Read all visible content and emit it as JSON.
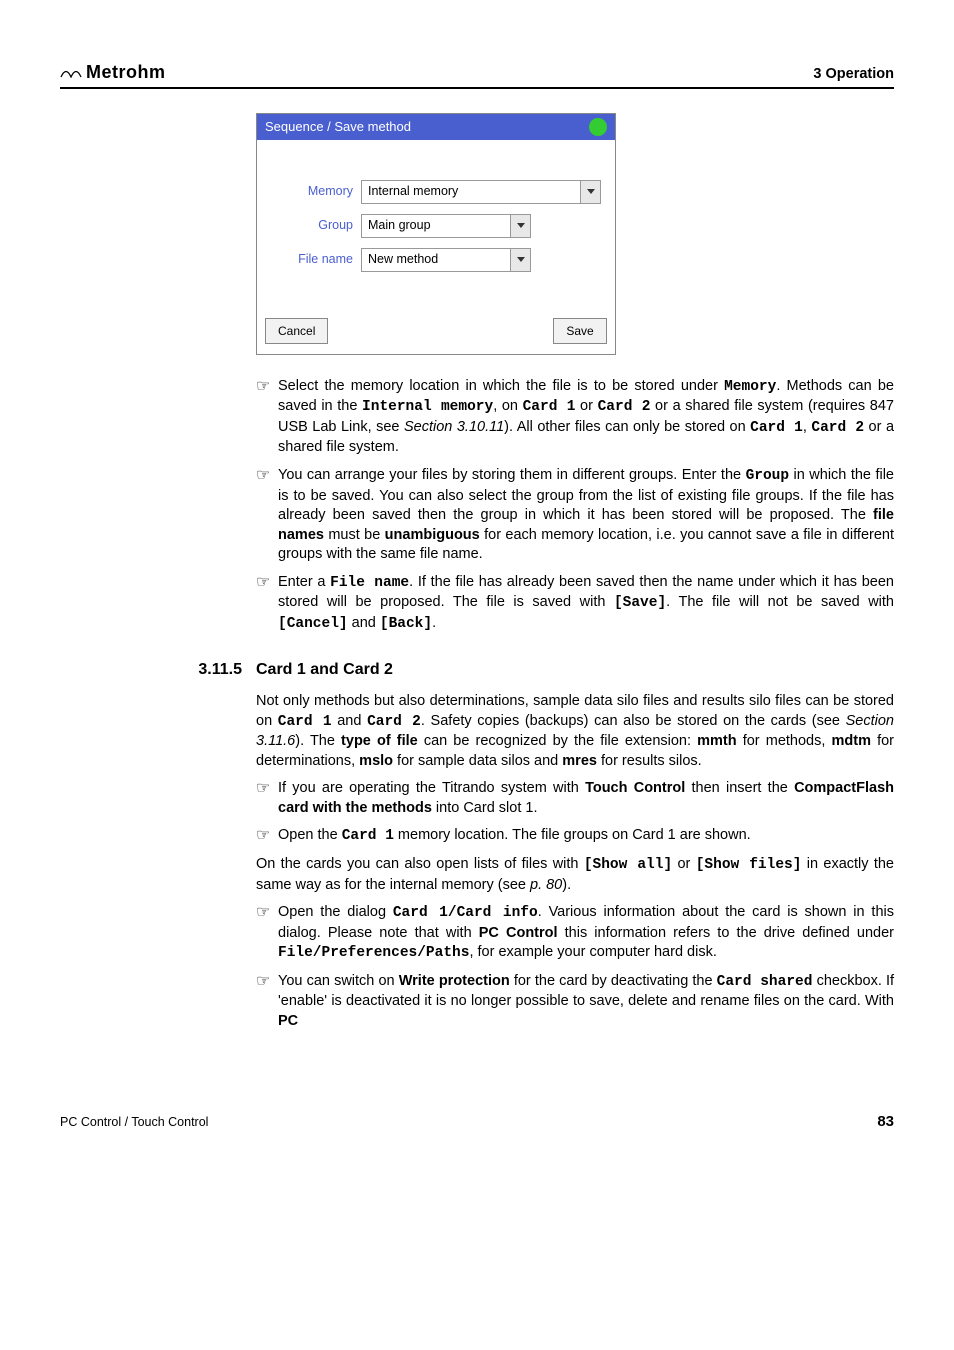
{
  "header": {
    "brand": "Metrohm",
    "section": "3 Operation"
  },
  "dialog": {
    "title": "Sequence / Save method",
    "rows": [
      {
        "label": "Memory",
        "value": "Internal memory",
        "wide": true
      },
      {
        "label": "Group",
        "value": "Main group",
        "wide": false
      },
      {
        "label": "File name",
        "value": "New method",
        "wide": false
      }
    ],
    "cancel": "Cancel",
    "save": "Save"
  },
  "bullets1": {
    "b1_a": "Select the memory location in which the file is to be stored under ",
    "b1_memory": "Memory",
    "b1_b": ". Methods can be saved in the ",
    "b1_internal": "Internal memory",
    "b1_c": ", on ",
    "b1_card1": "Card 1",
    "b1_d": " or ",
    "b1_card2": "Card 2",
    "b1_e": " or a shared file system (requires 847 USB Lab Link, see ",
    "b1_sect": "Section 3.10.11",
    "b1_f": "). All other files can only be stored on ",
    "b1_card1b": "Card 1",
    "b1_g": ", ",
    "b1_card2b": "Card 2",
    "b1_h": " or a shared file system.",
    "b2_a": "You can arrange your files by storing them in different groups. Enter the ",
    "b2_group": "Group",
    "b2_b": " in which the file is to be saved. You can also select the group from the list of existing file groups. If the file has already been saved then the group in which it has been stored will be proposed. The ",
    "b2_fn": "file names",
    "b2_c": " must be ",
    "b2_unamb": "unambiguous",
    "b2_d": " for each memory location, i.e. you cannot save a file in different groups with the same file name.",
    "b3_a": "Enter a ",
    "b3_fname": "File name",
    "b3_b": ". If the file has already been saved then the name under which it has been stored will be proposed. The file is saved with ",
    "b3_save": "[Save]",
    "b3_c": ". The file will not be saved with ",
    "b3_cancel": "[Cancel]",
    "b3_d": " and ",
    "b3_back": "[Back]",
    "b3_e": "."
  },
  "section2": {
    "num": "3.11.5",
    "title": "Card 1 and Card 2"
  },
  "para1": {
    "a": "Not only methods but also determinations, sample data silo files and results silo files can be stored on ",
    "card1": "Card 1",
    "b": " and ",
    "card2": "Card 2",
    "c": ". Safety copies (backups) can also be stored on the cards (see ",
    "sect": "Section 3.11.6",
    "d": "). The ",
    "tof": "type of file",
    "e": " can be recognized by the file extension: ",
    "mmth": "mmth",
    "f": " for methods, ",
    "mdtm": "mdtm",
    "g": " for determinations, ",
    "mslo": "mslo",
    "h": " for sample data silos and ",
    "mres": "mres",
    "i": " for results silos."
  },
  "bullets2": {
    "b4_a": "If you are operating the Titrando system with ",
    "b4_tc": "Touch Control",
    "b4_b": " then insert the ",
    "b4_cf": "CompactFlash card with the methods",
    "b4_c": " into Card slot 1.",
    "b5_a": "Open the ",
    "b5_card1": "Card 1",
    "b5_b": " memory location. The file groups on Card 1 are shown."
  },
  "para2": {
    "a": "On the cards you can also open lists of files with ",
    "showall": "[Show all]",
    "b": " or ",
    "showfiles": "[Show files]",
    "c": " in exactly the same way as for the internal memory (see ",
    "pref": "p. 80",
    "d": ")."
  },
  "bullets3": {
    "b6_a": "Open the dialog ",
    "b6_ci": "Card 1/Card info",
    "b6_b": ". Various information about the card is shown in this dialog. Please note that with ",
    "b6_pc": "PC Control",
    "b6_c": " this information refers to the drive defined under ",
    "b6_fpp": "File/Preferences/Paths",
    "b6_d": ", for example your computer hard disk.",
    "b7_a": "You can switch on ",
    "b7_wp": "Write protection",
    "b7_b": " for the card by deactivating the ",
    "b7_cs": "Card shared",
    "b7_c": " checkbox. If 'enable' is deactivated it is no longer possible to save, delete and rename files on the card. With ",
    "b7_pc": "PC"
  },
  "footer": {
    "left": "PC Control / Touch Control",
    "page": "83"
  }
}
